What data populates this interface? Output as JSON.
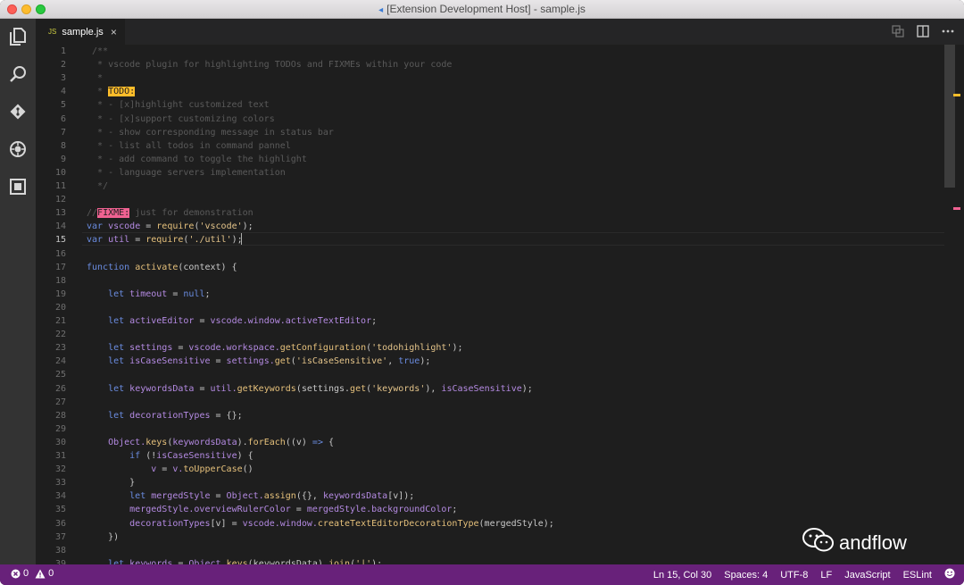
{
  "window": {
    "title": "[Extension Development Host] - sample.js",
    "title_icon": "vscode-icon"
  },
  "activity_bar": {
    "items": [
      "explorer-icon",
      "search-icon",
      "git-icon",
      "debug-icon",
      "extensions-icon"
    ]
  },
  "tabs": [
    {
      "lang_badge": "JS",
      "label": "sample.js",
      "close": "×"
    }
  ],
  "editor_actions": [
    "open-changes-icon",
    "split-editor-icon",
    "more-icon"
  ],
  "editor": {
    "current_line": 15,
    "lines": [
      {
        "n": "1",
        "t": [
          {
            "k": "c",
            "s": " /**"
          }
        ]
      },
      {
        "n": "2",
        "t": [
          {
            "k": "c",
            "s": "  * vscode plugin for highlighting TODOs and FIXMEs within your code"
          }
        ]
      },
      {
        "n": "3",
        "t": [
          {
            "k": "c",
            "s": "  *"
          }
        ]
      },
      {
        "n": "4",
        "t": [
          {
            "k": "c",
            "s": "  * "
          },
          {
            "k": "todo",
            "s": "TODO:"
          }
        ]
      },
      {
        "n": "5",
        "t": [
          {
            "k": "c",
            "s": "  * - [x]highlight customized text"
          }
        ]
      },
      {
        "n": "6",
        "t": [
          {
            "k": "c",
            "s": "  * - [x]support customizing colors"
          }
        ]
      },
      {
        "n": "7",
        "t": [
          {
            "k": "c",
            "s": "  * - show corresponding message in status bar"
          }
        ]
      },
      {
        "n": "8",
        "t": [
          {
            "k": "c",
            "s": "  * - list all todos in command pannel"
          }
        ]
      },
      {
        "n": "9",
        "t": [
          {
            "k": "c",
            "s": "  * - add command to toggle the highlight"
          }
        ]
      },
      {
        "n": "10",
        "t": [
          {
            "k": "c",
            "s": "  * - language servers implementation"
          }
        ]
      },
      {
        "n": "11",
        "t": [
          {
            "k": "c",
            "s": "  */"
          }
        ]
      },
      {
        "n": "12",
        "t": []
      },
      {
        "n": "13",
        "t": [
          {
            "k": "c",
            "s": "//"
          },
          {
            "k": "fixme",
            "s": "FIXME:"
          },
          {
            "k": "c",
            "s": " just for demonstration"
          }
        ]
      },
      {
        "n": "14",
        "t": [
          {
            "k": "kw",
            "s": "var "
          },
          {
            "k": "v",
            "s": "vscode"
          },
          {
            "k": "p",
            "s": " = "
          },
          {
            "k": "f",
            "s": "require"
          },
          {
            "k": "p",
            "s": "("
          },
          {
            "k": "s",
            "s": "'vscode'"
          },
          {
            "k": "p",
            "s": ");"
          }
        ]
      },
      {
        "n": "15",
        "t": [
          {
            "k": "kw",
            "s": "var "
          },
          {
            "k": "v",
            "s": "util"
          },
          {
            "k": "p",
            "s": " = "
          },
          {
            "k": "f",
            "s": "require"
          },
          {
            "k": "p",
            "s": "("
          },
          {
            "k": "s",
            "s": "'./util'"
          },
          {
            "k": "p",
            "s": ");"
          }
        ]
      },
      {
        "n": "16",
        "t": []
      },
      {
        "n": "17",
        "t": [
          {
            "k": "kw",
            "s": "function "
          },
          {
            "k": "f",
            "s": "activate"
          },
          {
            "k": "p",
            "s": "(context) {"
          }
        ]
      },
      {
        "n": "18",
        "t": []
      },
      {
        "n": "19",
        "t": [
          {
            "k": "kw",
            "s": "    let "
          },
          {
            "k": "v",
            "s": "timeout"
          },
          {
            "k": "p",
            "s": " = "
          },
          {
            "k": "kw",
            "s": "null"
          },
          {
            "k": "p",
            "s": ";"
          }
        ]
      },
      {
        "n": "20",
        "t": []
      },
      {
        "n": "21",
        "t": [
          {
            "k": "kw",
            "s": "    let "
          },
          {
            "k": "v",
            "s": "activeEditor"
          },
          {
            "k": "p",
            "s": " = "
          },
          {
            "k": "v",
            "s": "vscode.window.activeTextEditor"
          },
          {
            "k": "p",
            "s": ";"
          }
        ]
      },
      {
        "n": "22",
        "t": []
      },
      {
        "n": "23",
        "t": [
          {
            "k": "kw",
            "s": "    let "
          },
          {
            "k": "v",
            "s": "settings"
          },
          {
            "k": "p",
            "s": " = "
          },
          {
            "k": "v",
            "s": "vscode.workspace."
          },
          {
            "k": "f",
            "s": "getConfiguration"
          },
          {
            "k": "p",
            "s": "("
          },
          {
            "k": "s",
            "s": "'todohighlight'"
          },
          {
            "k": "p",
            "s": ");"
          }
        ]
      },
      {
        "n": "24",
        "t": [
          {
            "k": "kw",
            "s": "    let "
          },
          {
            "k": "v",
            "s": "isCaseSensitive"
          },
          {
            "k": "p",
            "s": " = "
          },
          {
            "k": "v",
            "s": "settings."
          },
          {
            "k": "f",
            "s": "get"
          },
          {
            "k": "p",
            "s": "("
          },
          {
            "k": "s",
            "s": "'isCaseSensitive'"
          },
          {
            "k": "p",
            "s": ", "
          },
          {
            "k": "kw",
            "s": "true"
          },
          {
            "k": "p",
            "s": ");"
          }
        ]
      },
      {
        "n": "25",
        "t": []
      },
      {
        "n": "26",
        "t": [
          {
            "k": "kw",
            "s": "    let "
          },
          {
            "k": "v",
            "s": "keywordsData"
          },
          {
            "k": "p",
            "s": " = "
          },
          {
            "k": "v",
            "s": "util."
          },
          {
            "k": "f",
            "s": "getKeywords"
          },
          {
            "k": "p",
            "s": "(settings."
          },
          {
            "k": "f",
            "s": "get"
          },
          {
            "k": "p",
            "s": "("
          },
          {
            "k": "s",
            "s": "'keywords'"
          },
          {
            "k": "p",
            "s": "), "
          },
          {
            "k": "v",
            "s": "isCaseSensitive"
          },
          {
            "k": "p",
            "s": ");"
          }
        ]
      },
      {
        "n": "27",
        "t": []
      },
      {
        "n": "28",
        "t": [
          {
            "k": "kw",
            "s": "    let "
          },
          {
            "k": "v",
            "s": "decorationTypes"
          },
          {
            "k": "p",
            "s": " = {};"
          }
        ]
      },
      {
        "n": "29",
        "t": []
      },
      {
        "n": "30",
        "t": [
          {
            "k": "v",
            "s": "    Object."
          },
          {
            "k": "f",
            "s": "keys"
          },
          {
            "k": "p",
            "s": "("
          },
          {
            "k": "v",
            "s": "keywordsData"
          },
          {
            "k": "p",
            "s": ")."
          },
          {
            "k": "f",
            "s": "forEach"
          },
          {
            "k": "p",
            "s": "((v) "
          },
          {
            "k": "kw",
            "s": "=>"
          },
          {
            "k": "p",
            "s": " {"
          }
        ]
      },
      {
        "n": "31",
        "t": [
          {
            "k": "kw",
            "s": "        if "
          },
          {
            "k": "p",
            "s": "(!"
          },
          {
            "k": "v",
            "s": "isCaseSensitive"
          },
          {
            "k": "p",
            "s": ") {"
          }
        ]
      },
      {
        "n": "32",
        "t": [
          {
            "k": "v",
            "s": "            v"
          },
          {
            "k": "p",
            "s": " = "
          },
          {
            "k": "v",
            "s": "v."
          },
          {
            "k": "f",
            "s": "toUpperCase"
          },
          {
            "k": "p",
            "s": "()"
          }
        ]
      },
      {
        "n": "33",
        "t": [
          {
            "k": "p",
            "s": "        }"
          }
        ]
      },
      {
        "n": "34",
        "t": [
          {
            "k": "kw",
            "s": "        let "
          },
          {
            "k": "v",
            "s": "mergedStyle"
          },
          {
            "k": "p",
            "s": " = "
          },
          {
            "k": "v",
            "s": "Object."
          },
          {
            "k": "f",
            "s": "assign"
          },
          {
            "k": "p",
            "s": "({}, "
          },
          {
            "k": "v",
            "s": "keywordsData"
          },
          {
            "k": "p",
            "s": "[v]);"
          }
        ]
      },
      {
        "n": "35",
        "t": [
          {
            "k": "v",
            "s": "        mergedStyle.overviewRulerColor"
          },
          {
            "k": "p",
            "s": " = "
          },
          {
            "k": "v",
            "s": "mergedStyle.backgroundColor"
          },
          {
            "k": "p",
            "s": ";"
          }
        ]
      },
      {
        "n": "36",
        "t": [
          {
            "k": "v",
            "s": "        decorationTypes"
          },
          {
            "k": "p",
            "s": "[v] = "
          },
          {
            "k": "v",
            "s": "vscode.window."
          },
          {
            "k": "f",
            "s": "createTextEditorDecorationType"
          },
          {
            "k": "p",
            "s": "(mergedStyle);"
          }
        ]
      },
      {
        "n": "37",
        "t": [
          {
            "k": "p",
            "s": "    })"
          }
        ]
      },
      {
        "n": "38",
        "t": []
      },
      {
        "n": "39",
        "t": [
          {
            "k": "kw",
            "s": "    let "
          },
          {
            "k": "v",
            "s": "keywords"
          },
          {
            "k": "p",
            "s": " = "
          },
          {
            "k": "v",
            "s": "Object."
          },
          {
            "k": "f",
            "s": "keys"
          },
          {
            "k": "p",
            "s": "(keywordsData)."
          },
          {
            "k": "f",
            "s": "join"
          },
          {
            "k": "p",
            "s": "("
          },
          {
            "k": "s",
            "s": "'|'"
          },
          {
            "k": "p",
            "s": ");"
          }
        ]
      }
    ]
  },
  "colors": {
    "status_bar": "#68217a",
    "todo_highlight": "#ffbd2a",
    "fixme_highlight": "#f06292"
  },
  "watermark": {
    "icon": "wechat-icon",
    "text": "andflow"
  },
  "status_bar": {
    "errors": "0",
    "warnings": "0",
    "position": "Ln 15, Col 30",
    "indent": "Spaces: 4",
    "encoding": "UTF-8",
    "eol": "LF",
    "language": "JavaScript",
    "linter": "ESLint",
    "feedback_icon": "smiley-icon"
  }
}
